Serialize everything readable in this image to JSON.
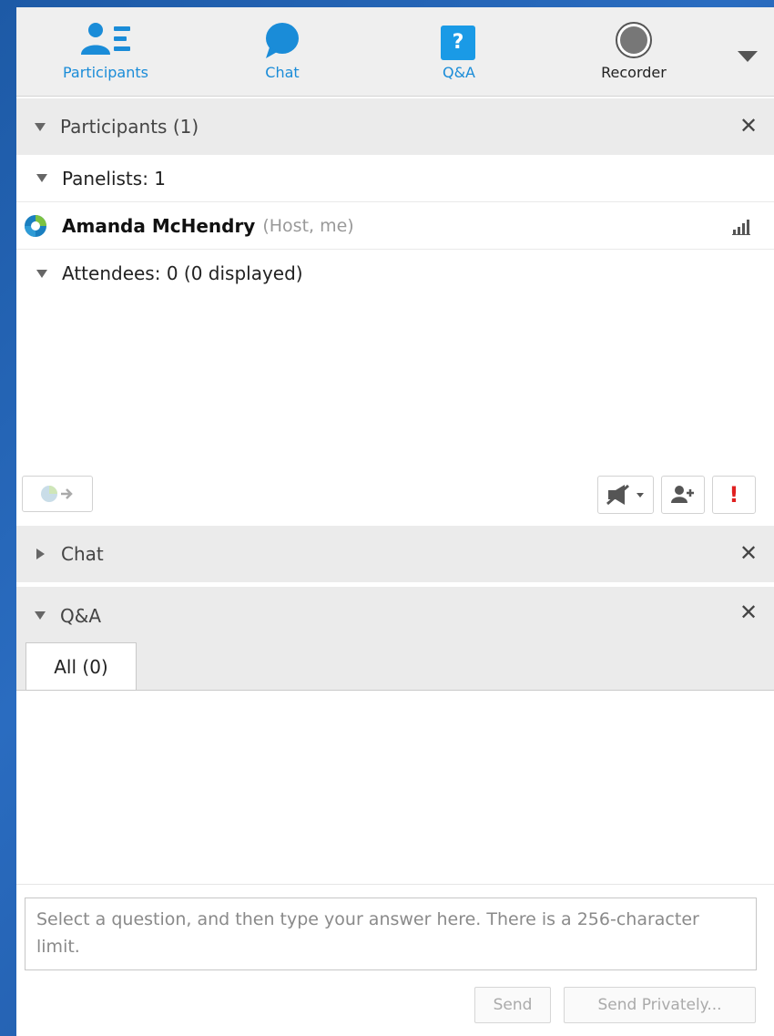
{
  "toolbar": {
    "participants_label": "Participants",
    "chat_label": "Chat",
    "qa_label": "Q&A",
    "qa_icon_char": "?",
    "recorder_label": "Recorder"
  },
  "participants_section": {
    "title": "Participants (1)",
    "close": "✕",
    "panelists_label": "Panelists: 1",
    "host": {
      "name": "Amanda McHendry",
      "role": "(Host, me)"
    },
    "attendees_label": "Attendees: 0 (0 displayed)",
    "alert_char": "!"
  },
  "chat_section": {
    "title": "Chat",
    "close": "✕"
  },
  "qa_section": {
    "title": "Q&A",
    "close": "✕",
    "tab_all": "All (0)",
    "answer_placeholder": "Select a question, and then type your answer here. There is a 256-character limit.",
    "send_label": "Send",
    "send_privately_label": "Send Privately..."
  },
  "colors": {
    "accent_blue": "#1a8cd8",
    "alert_red": "#e02020",
    "background_blue": "#1d5aa6"
  }
}
